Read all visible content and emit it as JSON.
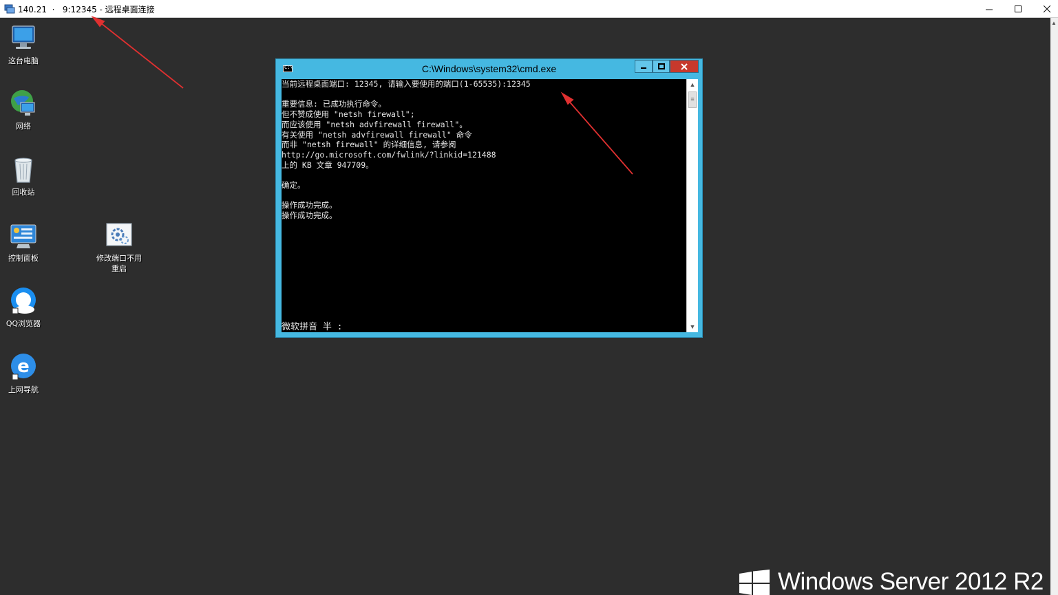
{
  "rdp_window": {
    "title": "140.21  ·   9:12345 - 远程桌面连接",
    "minimize_label": "—",
    "maximize_label": "☐",
    "close_label": "✕"
  },
  "desktop_icons": [
    {
      "label": "这台电脑",
      "icon": "computer-icon"
    },
    {
      "label": "网络",
      "icon": "network-icon"
    },
    {
      "label": "回收站",
      "icon": "recycle-bin-icon"
    },
    {
      "label": "控制面板",
      "icon": "control-panel-icon"
    },
    {
      "label": "修改端口不用重启",
      "icon": "port-tool-icon"
    },
    {
      "label": "QQ浏览器",
      "icon": "qq-browser-icon"
    },
    {
      "label": "上网导航",
      "icon": "internet-explorer-icon"
    }
  ],
  "cmd_window": {
    "title": "C:\\Windows\\system32\\cmd.exe",
    "icon_text": "C:\\",
    "lines": [
      "当前远程桌面端口: 12345, 请输入要使用的端口(1-65535):12345",
      "",
      "重要信息: 已成功执行命令。",
      "但不赞成使用 \"netsh firewall\";",
      "而应该使用 \"netsh advfirewall firewall\"。",
      "有关使用 \"netsh advfirewall firewall\" 命令",
      "而非 \"netsh firewall\" 的详细信息, 请参阅",
      "http://go.microsoft.com/fwlink/?linkid=121488",
      "上的 KB 文章 947709。",
      "",
      "确定。",
      "",
      "操作成功完成。",
      "操作成功完成。"
    ],
    "ime_status": "微软拼音 半 :"
  },
  "branding": {
    "product_name": "Windows Server 2012 R2"
  },
  "colors": {
    "desktop_bg": "#2d2d2d",
    "cmd_frame": "#45b8e1",
    "cmd_close": "#c7392c",
    "annotation_arrow": "#e03030"
  }
}
